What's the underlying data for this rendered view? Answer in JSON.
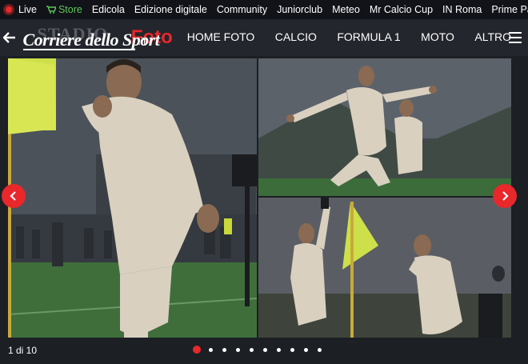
{
  "topbar": {
    "items": [
      {
        "label": "Live",
        "icon": "live-dot-icon",
        "color": "#ffffff"
      },
      {
        "label": "Store",
        "icon": "cart-icon",
        "color": "#5ec65b"
      },
      {
        "label": "Edicola"
      },
      {
        "label": "Edizione digitale"
      },
      {
        "label": "Community"
      },
      {
        "label": "Juniorclub"
      },
      {
        "label": "Meteo"
      },
      {
        "label": "Mr Calcio Cup"
      },
      {
        "label": "IN Roma"
      },
      {
        "label": "Prime Pagine"
      }
    ]
  },
  "header": {
    "logo_main": "Corriere dello Sport",
    "logo_ghost": "STADIO",
    "logo_suffix": ".it",
    "section_title": "Foto",
    "nav": [
      "HOME FOTO",
      "CALCIO",
      "FORMULA 1",
      "MOTO",
      "ALTRO"
    ]
  },
  "gallery": {
    "counter": "1 di 10",
    "total_slides": 10,
    "active_slide": 1
  },
  "colors": {
    "accent": "#e8282b",
    "store": "#5ec65b",
    "background": "#1c1f24",
    "header": "#23262c"
  }
}
